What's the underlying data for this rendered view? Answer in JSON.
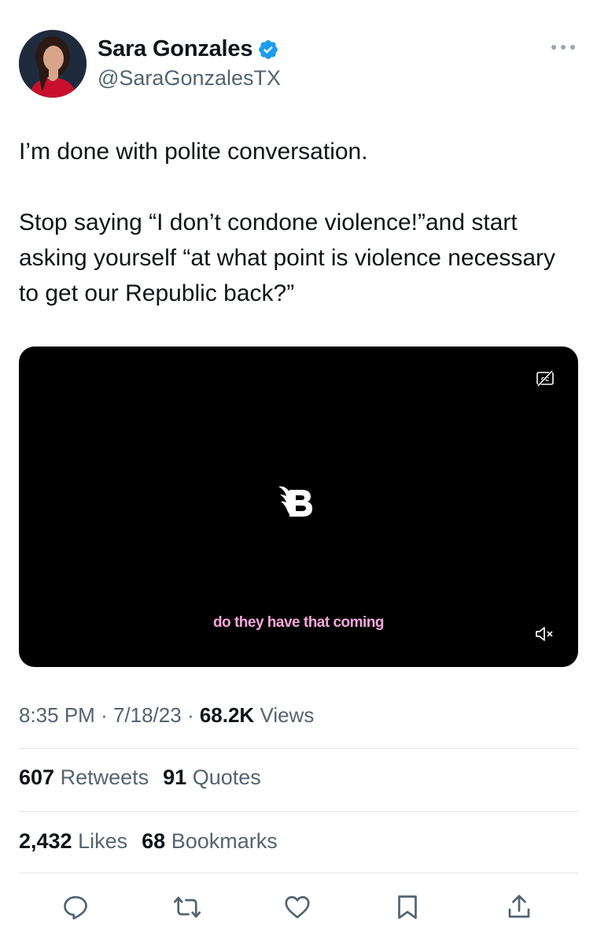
{
  "author": {
    "display_name": "Sara Gonzales",
    "handle": "@SaraGonzalesTX",
    "verified": true,
    "avatar_icon": "profile-photo"
  },
  "tweet": {
    "paragraphs": [
      "I’m done with polite conversation.",
      "Stop saying “I don’t condone violence!”and start asking yourself “at what point is violence necessary to get our Republic back?”"
    ]
  },
  "video": {
    "caption": "do they have that coming",
    "caption_color": "#f4a8d8",
    "logo_icon": "blaze-b-logo",
    "cc_icon": "closed-captions-off-icon",
    "mute_icon": "muted-speaker-icon"
  },
  "meta": {
    "time": "8:35 PM",
    "date": "7/18/23",
    "views_count": "68.2K",
    "views_label": "Views"
  },
  "stats": {
    "retweets_count": "607",
    "retweets_label": "Retweets",
    "quotes_count": "91",
    "quotes_label": "Quotes",
    "likes_count": "2,432",
    "likes_label": "Likes",
    "bookmarks_count": "68",
    "bookmarks_label": "Bookmarks"
  },
  "actions": [
    "reply-icon",
    "retweet-icon",
    "like-icon",
    "bookmark-icon",
    "share-icon"
  ],
  "colors": {
    "text": "#0f1419",
    "secondary": "#536471",
    "verified": "#1d9bf0",
    "divider": "#e3e7ea"
  }
}
